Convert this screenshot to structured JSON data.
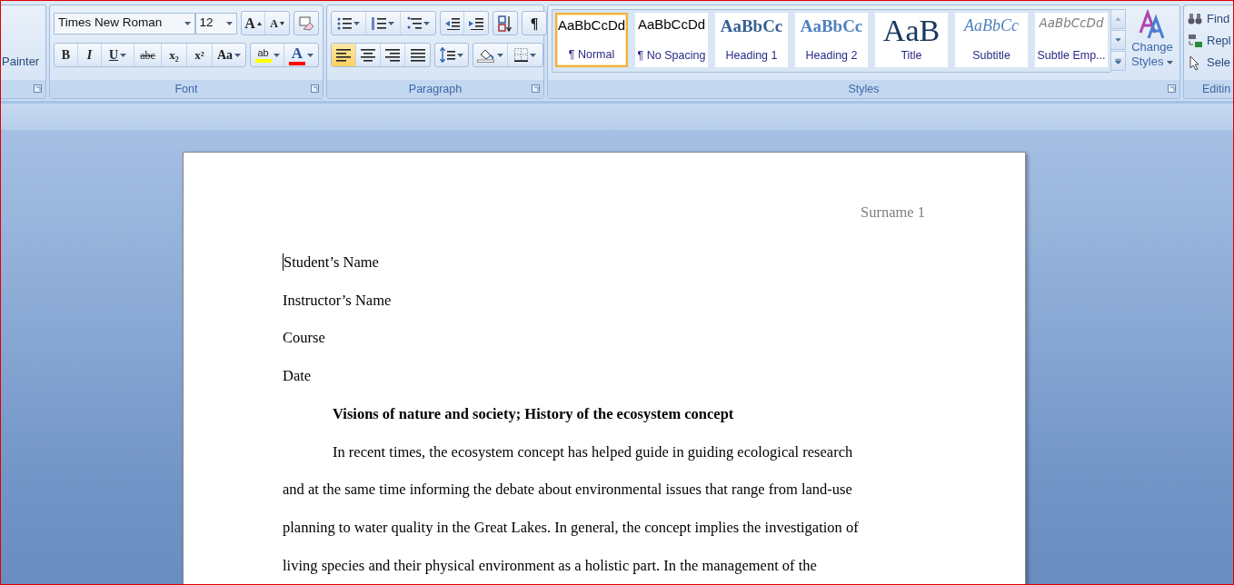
{
  "clipboard": {
    "label": "Painter"
  },
  "font": {
    "group_label": "Font",
    "font_name": "Times New Roman",
    "font_size": "12",
    "size_buttons": [
      {
        "kind": "grow",
        "text": "A"
      },
      {
        "kind": "shrink",
        "text": "A"
      }
    ],
    "format_buttons": [
      {
        "kind": "bold",
        "text": "B",
        "dropdown": false
      },
      {
        "kind": "italic",
        "text": "I",
        "dropdown": false
      },
      {
        "kind": "underline",
        "text": "U",
        "dropdown": true
      },
      {
        "kind": "strike",
        "text": "abc",
        "dropdown": false
      },
      {
        "kind": "subscript",
        "text": "x₂",
        "dropdown": false
      },
      {
        "kind": "superscript",
        "text": "x²",
        "dropdown": false
      },
      {
        "kind": "case",
        "text": "Aa",
        "dropdown": true
      }
    ],
    "color_buttons": [
      {
        "kind": "highlight",
        "text": "ab",
        "color": "#ffff00"
      },
      {
        "kind": "font-color",
        "text": "A",
        "color": "#ff0000"
      }
    ]
  },
  "paragraph": {
    "group_label": "Paragraph",
    "show_marks": "¶",
    "alignments": [
      {
        "kind": "left",
        "selected": true
      },
      {
        "kind": "center",
        "selected": false
      },
      {
        "kind": "right",
        "selected": false
      },
      {
        "kind": "justify",
        "selected": false
      }
    ]
  },
  "styles": {
    "group_label": "Styles",
    "change_styles": "Change Styles",
    "gallery": [
      {
        "kind": "normal",
        "preview": "AaBbCcDd",
        "label": "¶ Normal",
        "selected": true
      },
      {
        "kind": "nospacing",
        "preview": "AaBbCcDd",
        "label": "¶ No Spacing",
        "selected": false
      },
      {
        "kind": "heading1",
        "preview": "AaBbCc",
        "label": "Heading 1",
        "selected": false
      },
      {
        "kind": "heading2",
        "preview": "AaBbCc",
        "label": "Heading 2",
        "selected": false
      },
      {
        "kind": "title",
        "preview": "AaB",
        "label": "Title",
        "selected": false
      },
      {
        "kind": "subtitle",
        "preview": "AaBbCc",
        "label": "Subtitle",
        "selected": false
      },
      {
        "kind": "subtle",
        "preview": "AaBbCcDd",
        "label": "Subtle Emp...",
        "selected": false
      }
    ]
  },
  "editing": {
    "group_label": "Editin",
    "commands": [
      {
        "kind": "find",
        "label": "Find"
      },
      {
        "kind": "replace",
        "label": "Repl"
      },
      {
        "kind": "select",
        "label": "Sele"
      }
    ]
  },
  "document": {
    "header": "Surname 1",
    "lines": [
      {
        "kind": "plain",
        "text": "Student’s Name",
        "cursor": true
      },
      {
        "kind": "plain",
        "text": "Instructor’s Name",
        "cursor": false
      },
      {
        "kind": "plain",
        "text": "Course",
        "cursor": false
      },
      {
        "kind": "plain",
        "text": "Date",
        "cursor": false
      },
      {
        "kind": "heading",
        "text": "Visions of nature and society; History of the ecosystem concept",
        "cursor": false
      },
      {
        "kind": "indent",
        "text": "In recent times, the ecosystem concept has helped guide in guiding ecological research",
        "cursor": false
      },
      {
        "kind": "plain",
        "text": "and at the same time informing the debate about environmental issues that range from land-use",
        "cursor": false
      },
      {
        "kind": "plain",
        "text": "planning to water quality in the Great Lakes. In general, the concept implies the investigation of",
        "cursor": false
      },
      {
        "kind": "plain",
        "text": "living species and their physical environment as a holistic part. In the management of the",
        "cursor": false
      }
    ]
  }
}
